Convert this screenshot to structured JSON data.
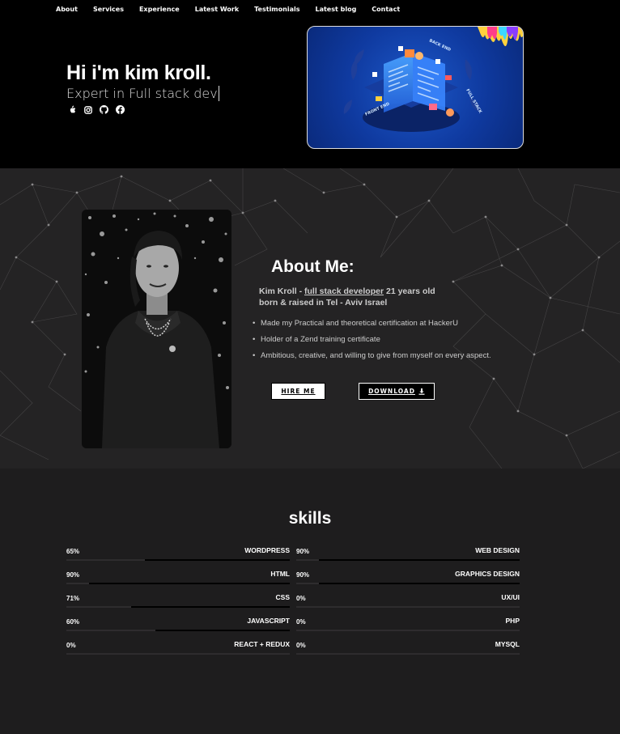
{
  "nav": [
    "About",
    "Services",
    "Experience",
    "Latest Work",
    "Testimonials",
    "Latest blog",
    "Contact"
  ],
  "hero": {
    "title": "Hi i'm kim kroll.",
    "subtitle_prefix": "Expert in ",
    "subtitle_typed": "Full stack dev",
    "socials": [
      "apple-icon",
      "instagram-icon",
      "github-icon",
      "facebook-icon"
    ],
    "illustration_labels": [
      "FRONT END",
      "BACK END",
      "FULL STACK"
    ]
  },
  "about": {
    "title": "About Me:",
    "intro_name": "Kim Kroll - ",
    "intro_role": "full stack developer",
    "intro_rest": " 21 years old born & raised in Tel - Aviv Israel",
    "bullets": [
      "Made my Practical and theoretical certification at HackerU",
      "Holder of a Zend training certificate",
      "Ambitious, creative, and willing to give from myself on every aspect."
    ],
    "hire_label": "HIRE ME",
    "download_label": "DOWNLOAD"
  },
  "skills": {
    "title": "skills",
    "left": [
      {
        "name": "WORDPRESS",
        "pct": "65%",
        "value": 65
      },
      {
        "name": "HTML",
        "pct": "90%",
        "value": 90
      },
      {
        "name": "CSS",
        "pct": "71%",
        "value": 71
      },
      {
        "name": "JAVASCRIPT",
        "pct": "60%",
        "value": 60
      },
      {
        "name": "REACT + REDUX",
        "pct": "0%",
        "value": 0
      }
    ],
    "right": [
      {
        "name": "WEB DESIGN",
        "pct": "90%",
        "value": 90
      },
      {
        "name": "GRAPHICS DESIGN",
        "pct": "90%",
        "value": 90
      },
      {
        "name": "UX/UI",
        "pct": "0%",
        "value": 0
      },
      {
        "name": "PHP",
        "pct": "0%",
        "value": 0
      },
      {
        "name": "MYSQL",
        "pct": "0%",
        "value": 0
      }
    ]
  }
}
